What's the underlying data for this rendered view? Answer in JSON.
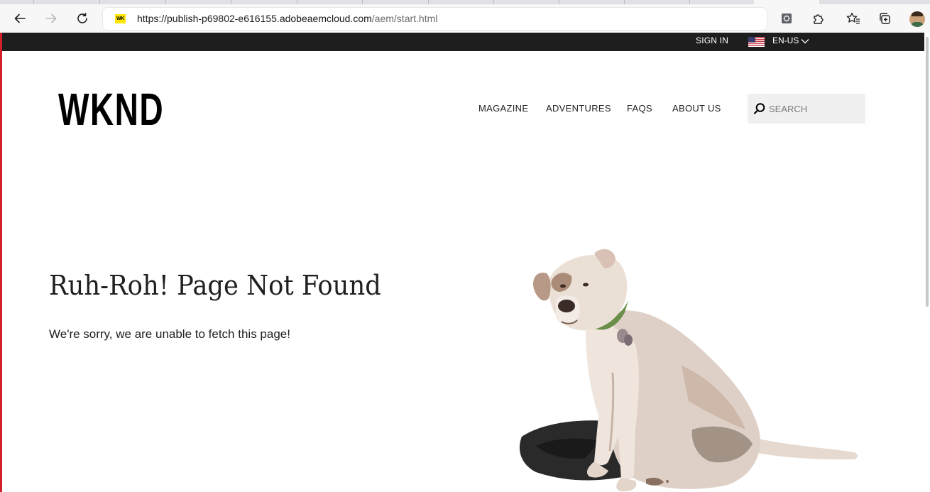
{
  "browser": {
    "url_host": "https://publish-p69802-e616155.adobeaemcloud.com",
    "url_path": "/aem/start.html",
    "favicon_text": "WK",
    "icons": [
      "back-icon",
      "forward-icon",
      "refresh-icon",
      "extension-icon",
      "puzzle-icon",
      "favorites-icon",
      "collections-icon",
      "profile-avatar"
    ]
  },
  "topbar": {
    "sign_in": "SIGN IN",
    "language": "EN-US",
    "flag": "us-flag-icon"
  },
  "header": {
    "logo": "WKND",
    "nav": [
      "MAGAZINE",
      "ADVENTURES",
      "FAQS",
      "ABOUT US"
    ],
    "search_placeholder": "SEARCH"
  },
  "main": {
    "title": "Ruh-Roh! Page Not Found",
    "message": "We're sorry, we are unable to fetch this page!"
  },
  "colors": {
    "topbar_bg": "#1e1e1e",
    "logo_yellow": "#ffe600",
    "text": "#202020",
    "search_bg": "#f0f0f0"
  }
}
